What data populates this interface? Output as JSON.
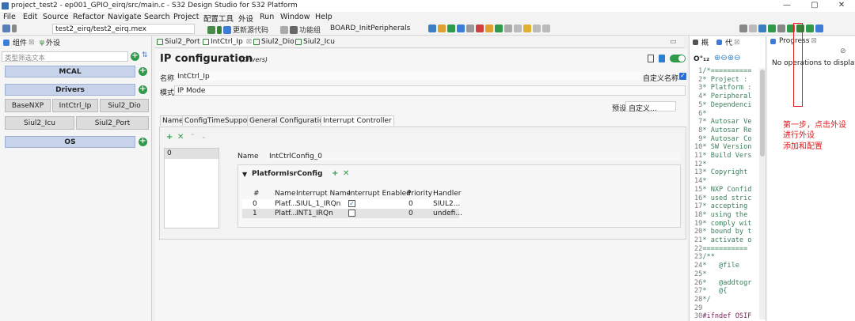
{
  "window": {
    "title": "project_test2 - ep001_GPIO_eirq/src/main.c - S32 Design Studio for S32 Platform",
    "controls": [
      "—",
      "▢",
      "✕"
    ]
  },
  "menu": [
    "File",
    "Edit",
    "Source",
    "Refactor",
    "Navigate",
    "Search",
    "Project",
    "配置工具",
    "外设",
    "Run",
    "Window",
    "Help"
  ],
  "toolbar": {
    "path": "test2_eirq/test2_eirq.mex",
    "update_code": "更新源代码",
    "function_group_label": "功能组",
    "function_group_value": "BOARD_InitPeripherals"
  },
  "left_panel": {
    "tab_components": "组件",
    "tab_peripherals": "外设",
    "filter_placeholder": "类型筛选文本",
    "groups": [
      "MCAL",
      "Drivers",
      "OS"
    ],
    "driver_items": [
      "BaseNXP",
      "IntCtrl_Ip",
      "Siul2_Dio",
      "Siul2_Icu",
      "Siul2_Port"
    ]
  },
  "editor_tabs": [
    "Siul2_Port",
    "IntCtrl_Ip",
    "Siul2_Dio",
    "Siul2_Icu"
  ],
  "editor": {
    "title": "IP configuration",
    "subtitle": "(Drivers)",
    "name_label": "名称",
    "name_value": "IntCtrl_Ip",
    "custom_name": "自定义名称",
    "mode_label": "模式",
    "mode_value": "IP Mode",
    "preset_label": "预设",
    "preset_value": "自定义...",
    "tabs": [
      "Name",
      "ConfigTimeSupport",
      "General Configuration",
      "Interrupt Controller"
    ],
    "list_item": "0",
    "config_name_label": "Name",
    "config_name_value": "IntCtrlConfig_0",
    "section": "PlatformIsrConfig",
    "columns": [
      "#",
      "Name",
      "Interrupt Name",
      "Interrupt Enabled",
      "Priority",
      "Handler"
    ],
    "rows": [
      {
        "n": "0",
        "name": "Platf...",
        "irq": "SIUL_1_IRQn",
        "enabled": true,
        "priority": "0",
        "handler": "SIUL2..."
      },
      {
        "n": "1",
        "name": "Platf...",
        "irq": "INT1_IRQn",
        "enabled": false,
        "priority": "0",
        "handler": "undefi..."
      }
    ]
  },
  "outline": {
    "tab1": "概",
    "tab2": "代",
    "zoom_label": "O°₁₂",
    "lines": [
      [
        "1",
        "/*=========="
      ],
      [
        "2",
        "* Project :"
      ],
      [
        "3",
        "* Platform :"
      ],
      [
        "4",
        "* Peripheral"
      ],
      [
        "5",
        "* Dependenci"
      ],
      [
        "6",
        "*"
      ],
      [
        "7",
        "* Autosar Ve"
      ],
      [
        "8",
        "* Autosar Re"
      ],
      [
        "9",
        "* Autosar Co"
      ],
      [
        "10",
        "* SW Version"
      ],
      [
        "11",
        "* Build Vers"
      ],
      [
        "12",
        "*"
      ],
      [
        "13",
        "* Copyright"
      ],
      [
        "14",
        "*"
      ],
      [
        "15",
        "* NXP Confid"
      ],
      [
        "16",
        "* used stric"
      ],
      [
        "17",
        "* accepting"
      ],
      [
        "18",
        "* using the"
      ],
      [
        "19",
        "* comply wit"
      ],
      [
        "20",
        "* bound by t"
      ],
      [
        "21",
        "* activate o"
      ],
      [
        "22",
        "==========="
      ],
      [
        "23",
        "/**"
      ],
      [
        "24",
        "*   @file"
      ],
      [
        "25",
        "*"
      ],
      [
        "26",
        "*   @addtogr"
      ],
      [
        "27",
        "*   @{"
      ],
      [
        "28",
        "*/"
      ],
      [
        "29",
        ""
      ],
      [
        "30",
        "#ifndef OSIF"
      ]
    ]
  },
  "progress": {
    "tab": "Progress",
    "message": "No operations to display a"
  },
  "annotation": [
    "第一步，点击外设",
    "进行外设",
    "添加和配置"
  ],
  "colors": {
    "annotation": "#e11a1a",
    "group_bar": "#c6d3ea",
    "toggle": "#2e9a4a",
    "accent": "#2d6fd1"
  }
}
